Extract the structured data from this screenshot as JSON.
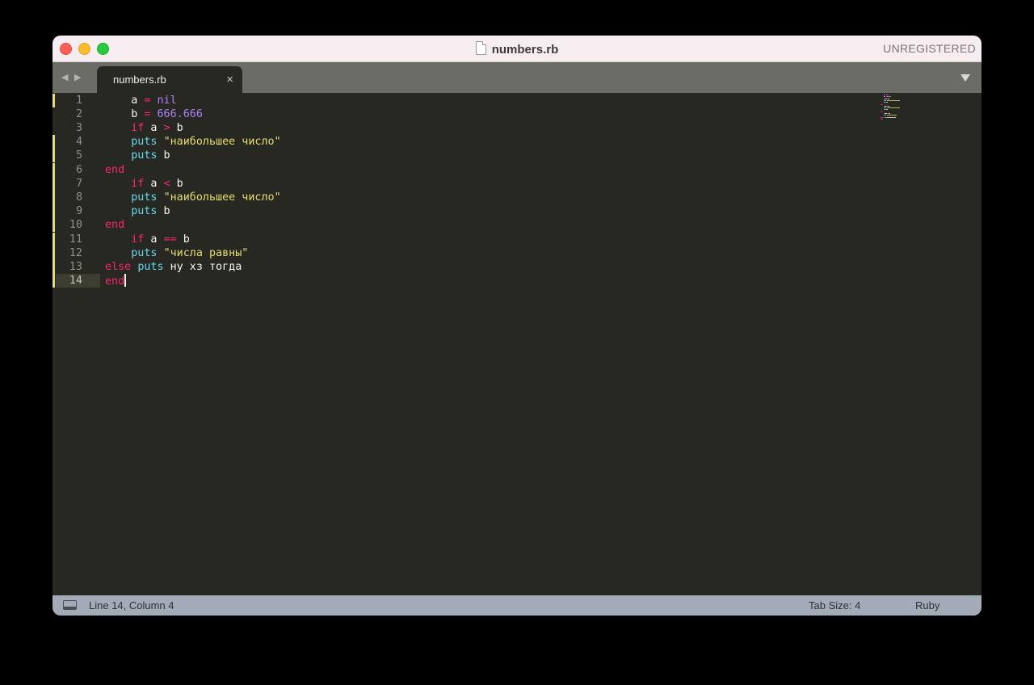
{
  "window": {
    "title": "numbers.rb",
    "license_status": "UNREGISTERED"
  },
  "tabs": [
    {
      "label": "numbers.rb",
      "close_glyph": "×",
      "active": true
    }
  ],
  "nav": {
    "back_glyph": "◀",
    "forward_glyph": "▶"
  },
  "editor": {
    "lines": [
      {
        "number": "1",
        "modified": true,
        "tokens": [
          {
            "t": "    "
          },
          {
            "t": "a",
            "c": "plain"
          },
          {
            "t": " "
          },
          {
            "t": "=",
            "c": "op"
          },
          {
            "t": " "
          },
          {
            "t": "nil",
            "c": "const"
          }
        ]
      },
      {
        "number": "2",
        "modified": false,
        "tokens": [
          {
            "t": "    "
          },
          {
            "t": "b",
            "c": "plain"
          },
          {
            "t": " "
          },
          {
            "t": "=",
            "c": "op"
          },
          {
            "t": " "
          },
          {
            "t": "666.666",
            "c": "num"
          }
        ]
      },
      {
        "number": "3",
        "modified": false,
        "tokens": [
          {
            "t": "    "
          },
          {
            "t": "if",
            "c": "kw"
          },
          {
            "t": " a "
          },
          {
            "t": ">",
            "c": "op"
          },
          {
            "t": " b"
          }
        ]
      },
      {
        "number": "4",
        "modified": true,
        "tokens": [
          {
            "t": "    "
          },
          {
            "t": "puts",
            "c": "fn"
          },
          {
            "t": " "
          },
          {
            "t": "\"наибольшее число\"",
            "c": "str"
          }
        ]
      },
      {
        "number": "5",
        "modified": true,
        "tokens": [
          {
            "t": "    "
          },
          {
            "t": "puts",
            "c": "fn"
          },
          {
            "t": " b"
          }
        ]
      },
      {
        "number": "6",
        "modified": true,
        "tokens": [
          {
            "t": "end",
            "c": "kw"
          }
        ]
      },
      {
        "number": "7",
        "modified": true,
        "tokens": [
          {
            "t": "    "
          },
          {
            "t": "if",
            "c": "kw"
          },
          {
            "t": " a "
          },
          {
            "t": "<",
            "c": "op"
          },
          {
            "t": " b"
          }
        ]
      },
      {
        "number": "8",
        "modified": true,
        "tokens": [
          {
            "t": "    "
          },
          {
            "t": "puts",
            "c": "fn"
          },
          {
            "t": " "
          },
          {
            "t": "\"наибольшее число\"",
            "c": "str"
          }
        ]
      },
      {
        "number": "9",
        "modified": true,
        "tokens": [
          {
            "t": "    "
          },
          {
            "t": "puts",
            "c": "fn"
          },
          {
            "t": " b"
          }
        ]
      },
      {
        "number": "10",
        "modified": true,
        "tokens": [
          {
            "t": "end",
            "c": "kw"
          }
        ]
      },
      {
        "number": "11",
        "modified": true,
        "tokens": [
          {
            "t": "    "
          },
          {
            "t": "if",
            "c": "kw"
          },
          {
            "t": " a "
          },
          {
            "t": "==",
            "c": "op"
          },
          {
            "t": " b"
          }
        ]
      },
      {
        "number": "12",
        "modified": true,
        "tokens": [
          {
            "t": "    "
          },
          {
            "t": "puts",
            "c": "fn"
          },
          {
            "t": " "
          },
          {
            "t": "\"числа равны\"",
            "c": "str"
          }
        ]
      },
      {
        "number": "13",
        "modified": true,
        "tokens": [
          {
            "t": "else",
            "c": "kw"
          },
          {
            "t": " "
          },
          {
            "t": "puts",
            "c": "fn"
          },
          {
            "t": " ну хз тогда"
          }
        ]
      },
      {
        "number": "14",
        "modified": true,
        "current": true,
        "tokens": [
          {
            "t": "end",
            "c": "kw"
          }
        ]
      }
    ]
  },
  "status": {
    "position": "Line 14, Column 4",
    "tab_size": "Tab Size: 4",
    "syntax": "Ruby"
  },
  "colors": {
    "background": "#272822",
    "keyword": "#f92672",
    "function": "#66d9ef",
    "string": "#e6db74",
    "number": "#ae81ff",
    "text": "#f8f8f2",
    "statusbar": "#a3aab8"
  }
}
